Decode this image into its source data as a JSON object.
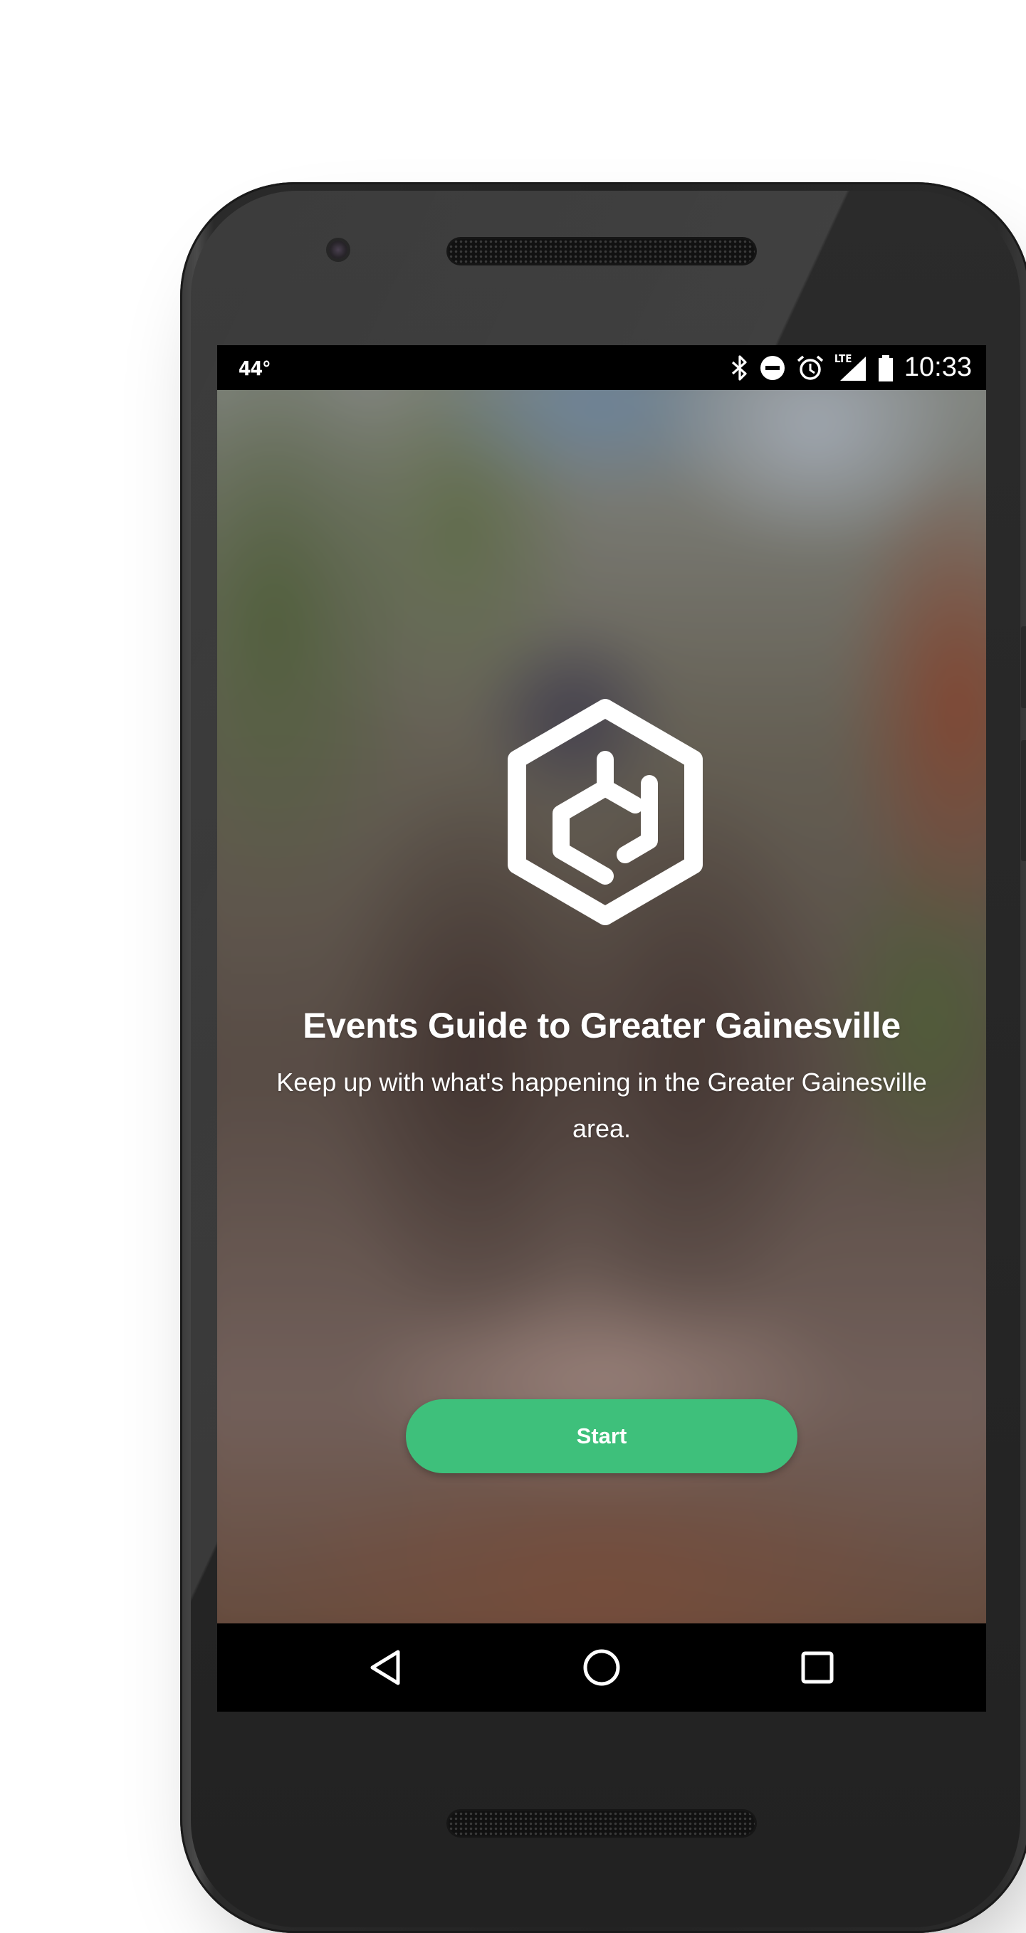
{
  "status_bar": {
    "temperature": "44°",
    "icons": [
      "bluetooth-icon",
      "do-not-disturb-icon",
      "alarm-icon",
      "lte-signal-icon",
      "battery-icon"
    ],
    "lte_label": "LTE",
    "time": "10:33"
  },
  "app": {
    "logo_icon": "cube-logo-icon",
    "title": "Events Guide to Greater Gainesville",
    "subtitle": "Keep up with what's happening in the Greater Gainesville area.",
    "start_button": "Start",
    "accent_color": "#3ec07b"
  },
  "nav_bar": {
    "buttons": [
      "back-icon",
      "home-icon",
      "recents-icon"
    ]
  }
}
